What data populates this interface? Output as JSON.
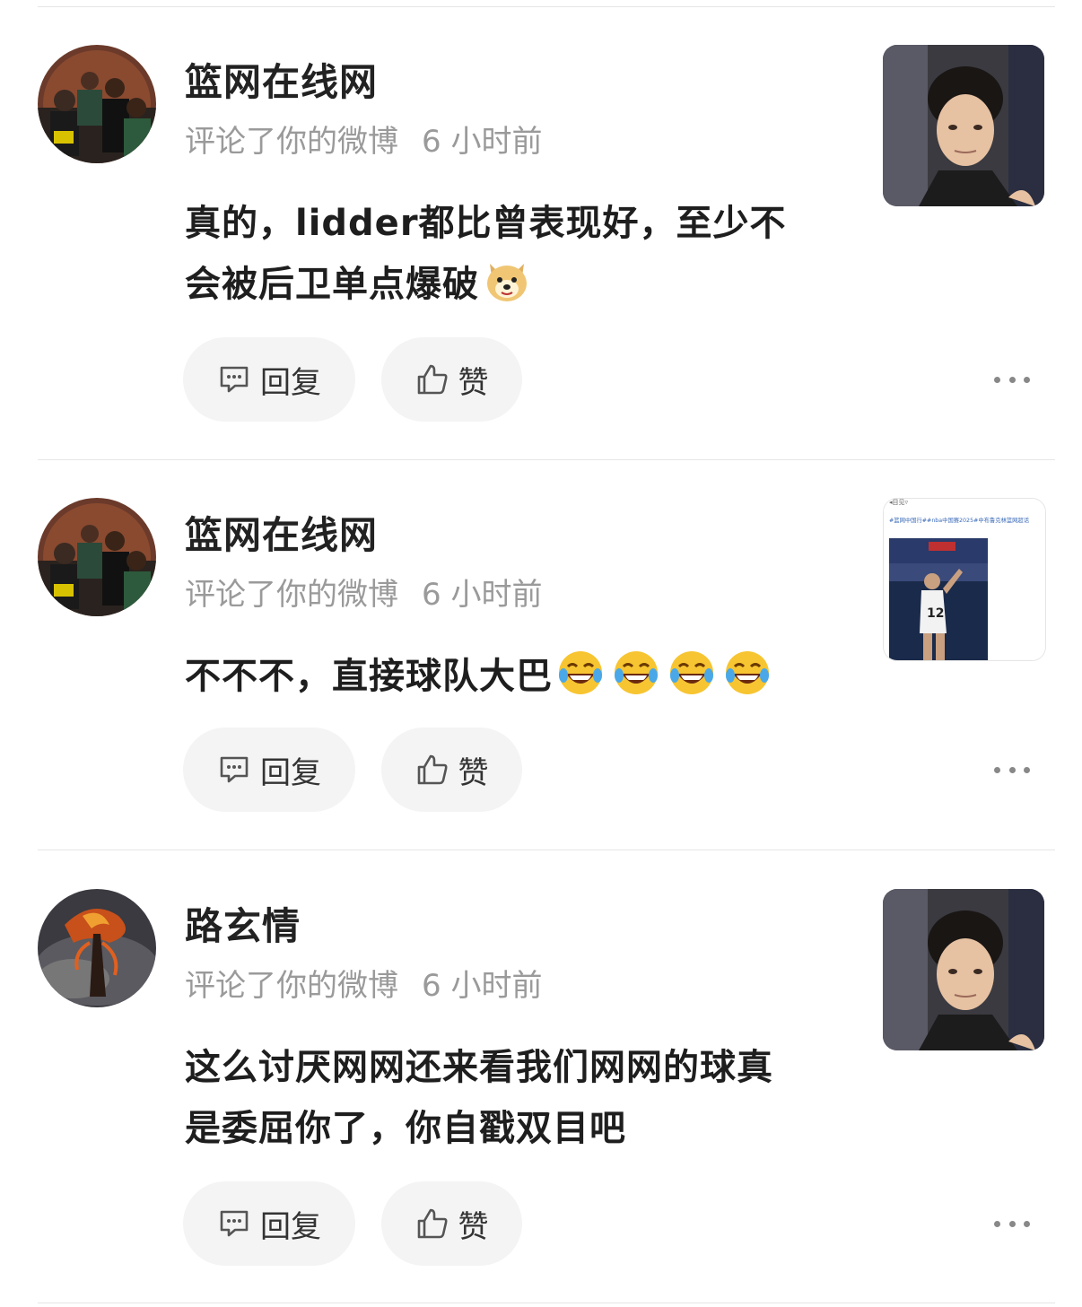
{
  "comments": [
    {
      "username": "篮网在线网",
      "action": "评论了你的微博",
      "time": "6 小时前",
      "text_lines": [
        "真的，lidder都比曾表现好，至少不",
        "会被后卫单点爆破"
      ],
      "emojis": [
        "doge-emoji"
      ],
      "reply_label": "回复",
      "like_label": "赞"
    },
    {
      "username": "篮网在线网",
      "action": "评论了你的微博",
      "time": "6 小时前",
      "text_lines": [
        "不不不，直接球队大巴"
      ],
      "emojis": [
        "laughing-tears-emoji",
        "laughing-tears-emoji",
        "laughing-tears-emoji",
        "laughing-tears-emoji"
      ],
      "reply_label": "回复",
      "like_label": "赞",
      "thumb_caption": "#篮网中国行##nba中国赛2025#中布鲁克林篮网超话",
      "thumb_header": "◂目见▿",
      "thumb_jersey": "12"
    },
    {
      "username": "路玄情",
      "action": "评论了你的微博",
      "time": "6 小时前",
      "text_lines": [
        "这么讨厌网网还来看我们网网的球真",
        "是委屈你了，你自戳双目吧"
      ],
      "emojis": [],
      "reply_label": "回复",
      "like_label": "赞"
    }
  ],
  "icons": {
    "reply": "comment-bubble-icon",
    "like": "thumbs-up-icon",
    "more": "more-dots-icon"
  },
  "colors": {
    "meta": "#9a9a9a",
    "pill_bg": "#f4f4f4",
    "divider": "#e6e6e6"
  }
}
